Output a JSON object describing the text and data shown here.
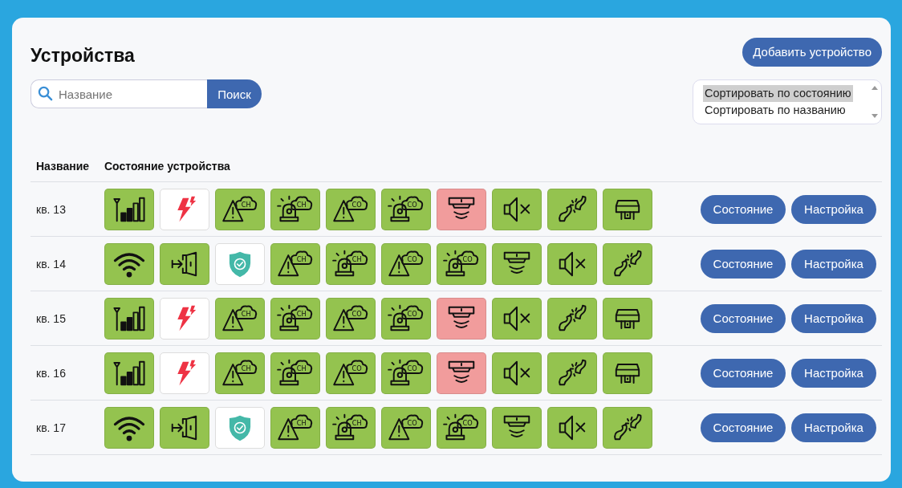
{
  "title": "Устройства",
  "add_button": "Добавить устройство",
  "search": {
    "placeholder": "Название",
    "button": "Поиск"
  },
  "sort_options": [
    {
      "label": "Сортировать по состоянию",
      "selected": true
    },
    {
      "label": "Сортировать по названию",
      "selected": false
    }
  ],
  "table": {
    "columns": [
      "Название",
      "Состояние устройства"
    ],
    "rows": [
      {
        "name": "кв. 13",
        "actions": [
          "Состояние",
          "Настройка"
        ],
        "indicators": [
          {
            "kind": "signal",
            "color": "#94c34f"
          },
          {
            "kind": "power",
            "color": "#ffffff"
          },
          {
            "kind": "warning",
            "gas": "CH",
            "color": "#94c34f"
          },
          {
            "kind": "siren",
            "gas": "CH",
            "color": "#94c34f"
          },
          {
            "kind": "warning",
            "gas": "CO",
            "color": "#94c34f"
          },
          {
            "kind": "siren",
            "gas": "CO",
            "color": "#94c34f"
          },
          {
            "kind": "smoke",
            "color": "#f19c9c"
          },
          {
            "kind": "mute",
            "color": "#94c34f"
          },
          {
            "kind": "pipe",
            "color": "#94c34f"
          },
          {
            "kind": "valve",
            "color": "#94c34f"
          }
        ]
      },
      {
        "name": "кв. 14",
        "actions": [
          "Состояние",
          "Настройка"
        ],
        "indicators": [
          {
            "kind": "wifi",
            "color": "#94c34f"
          },
          {
            "kind": "door",
            "color": "#94c34f"
          },
          {
            "kind": "shield",
            "color": "#ffffff"
          },
          {
            "kind": "warning",
            "gas": "CH",
            "color": "#94c34f"
          },
          {
            "kind": "siren",
            "gas": "CH",
            "color": "#94c34f"
          },
          {
            "kind": "warning",
            "gas": "CO",
            "color": "#94c34f"
          },
          {
            "kind": "siren",
            "gas": "CO",
            "color": "#94c34f"
          },
          {
            "kind": "smoke",
            "color": "#94c34f"
          },
          {
            "kind": "mute",
            "color": "#94c34f"
          },
          {
            "kind": "pipe",
            "color": "#94c34f"
          }
        ]
      },
      {
        "name": "кв. 15",
        "actions": [
          "Состояние",
          "Настройка"
        ],
        "indicators": [
          {
            "kind": "signal",
            "color": "#94c34f"
          },
          {
            "kind": "power",
            "color": "#ffffff"
          },
          {
            "kind": "warning",
            "gas": "CH",
            "color": "#94c34f"
          },
          {
            "kind": "siren",
            "gas": "CH",
            "color": "#94c34f"
          },
          {
            "kind": "warning",
            "gas": "CO",
            "color": "#94c34f"
          },
          {
            "kind": "siren",
            "gas": "CO",
            "color": "#94c34f"
          },
          {
            "kind": "smoke",
            "color": "#f19c9c"
          },
          {
            "kind": "mute",
            "color": "#94c34f"
          },
          {
            "kind": "pipe",
            "color": "#94c34f"
          },
          {
            "kind": "valve",
            "color": "#94c34f"
          }
        ]
      },
      {
        "name": "кв. 16",
        "actions": [
          "Состояние",
          "Настройка"
        ],
        "indicators": [
          {
            "kind": "signal",
            "color": "#94c34f"
          },
          {
            "kind": "power",
            "color": "#ffffff"
          },
          {
            "kind": "warning",
            "gas": "CH",
            "color": "#94c34f"
          },
          {
            "kind": "siren",
            "gas": "CH",
            "color": "#94c34f"
          },
          {
            "kind": "warning",
            "gas": "CO",
            "color": "#94c34f"
          },
          {
            "kind": "siren",
            "gas": "CO",
            "color": "#94c34f"
          },
          {
            "kind": "smoke",
            "color": "#f19c9c"
          },
          {
            "kind": "mute",
            "color": "#94c34f"
          },
          {
            "kind": "pipe",
            "color": "#94c34f"
          },
          {
            "kind": "valve",
            "color": "#94c34f"
          }
        ]
      },
      {
        "name": "кв. 17",
        "actions": [
          "Состояние",
          "Настройка"
        ],
        "indicators": [
          {
            "kind": "wifi",
            "color": "#94c34f"
          },
          {
            "kind": "door",
            "color": "#94c34f"
          },
          {
            "kind": "shield",
            "color": "#ffffff"
          },
          {
            "kind": "warning",
            "gas": "CH",
            "color": "#94c34f"
          },
          {
            "kind": "siren",
            "gas": "CH",
            "color": "#94c34f"
          },
          {
            "kind": "warning",
            "gas": "CO",
            "color": "#94c34f"
          },
          {
            "kind": "siren",
            "gas": "CO",
            "color": "#94c34f"
          },
          {
            "kind": "smoke",
            "color": "#94c34f"
          },
          {
            "kind": "mute",
            "color": "#94c34f"
          },
          {
            "kind": "pipe",
            "color": "#94c34f"
          }
        ]
      }
    ]
  }
}
